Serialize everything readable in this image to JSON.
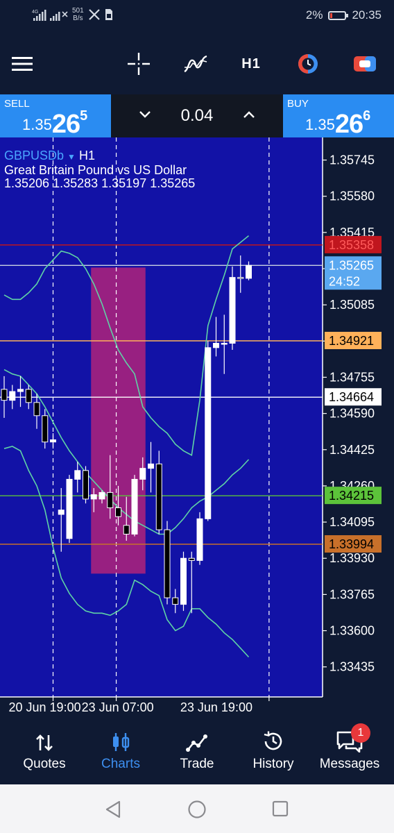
{
  "status_bar": {
    "network_speed_value": "501",
    "network_speed_unit": "B/s",
    "battery_percent": "2%",
    "time": "20:35"
  },
  "toolbar": {
    "timeframe": "H1",
    "icons": [
      "menu-icon",
      "crosshair-icon",
      "indicators-icon",
      "one-click-trading-icon",
      "trade-toggle-icon"
    ]
  },
  "trade": {
    "sell_label": "SELL",
    "sell_price_prefix": "1.35",
    "sell_price_big": "26",
    "sell_price_sup": "5",
    "buy_label": "BUY",
    "buy_price_prefix": "1.35",
    "buy_price_big": "26",
    "buy_price_sup": "6",
    "lot": "0.04"
  },
  "chart": {
    "symbol": "GBPUSDb",
    "timeframe": "H1",
    "description": "Great Britain Pound vs US Dollar",
    "ohlc": "1.35206 1.35283 1.35197 1.35265",
    "countdown": "24:52"
  },
  "colors": {
    "chart_bg": "#1212a6",
    "accent": "#2a8cf2",
    "bollinger": "#5fd3a6",
    "zone": "#b0237a",
    "bull": "#ffffff",
    "bear": "#000000"
  },
  "chart_data": {
    "type": "candlestick",
    "price_axis_ticks": [
      "1.35745",
      "1.35580",
      "1.35415",
      "1.35250",
      "1.35085",
      "1.34920",
      "1.34755",
      "1.34590",
      "1.34425",
      "1.34260",
      "1.34095",
      "1.33930",
      "1.33765",
      "1.33600",
      "1.33435"
    ],
    "time_axis_labels": [
      "20 Jun 19:00",
      "23 Jun 07:00",
      "23 Jun 19:00"
    ],
    "ylim": [
      1.33298,
      1.35848
    ],
    "horizontal_levels": [
      {
        "label": "1.35358",
        "price": 1.35358,
        "color": "#c0161e",
        "text_color": "#ff5a5a"
      },
      {
        "label": "1.35265",
        "price": 1.35265,
        "color": "#c8d0e0",
        "text_color": "#ffffff",
        "current": true
      },
      {
        "label": "1.34921",
        "price": 1.34921,
        "color": "#ffb15a",
        "text_color": "#000000"
      },
      {
        "label": "1.34664",
        "price": 1.34664,
        "color": "#ffffff",
        "text_color": "#000000"
      },
      {
        "label": "1.34215",
        "price": 1.34215,
        "color": "#5cc33a",
        "text_color": "#000000"
      },
      {
        "label": "1.33994",
        "price": 1.33994,
        "color": "#c8702a",
        "text_color": "#000000"
      }
    ],
    "candles": [
      [
        1.347,
        1.3476,
        1.3457,
        1.3465
      ],
      [
        1.3465,
        1.3472,
        1.3461,
        1.3469
      ],
      [
        1.3469,
        1.3476,
        1.3462,
        1.347
      ],
      [
        1.347,
        1.3472,
        1.3461,
        1.3464
      ],
      [
        1.3464,
        1.3468,
        1.3452,
        1.3458
      ],
      [
        1.3458,
        1.3461,
        1.3443,
        1.3446
      ],
      [
        1.3446,
        1.345,
        1.3443,
        1.3447
      ],
      [
        1.3413,
        1.3425,
        1.3396,
        1.3415
      ],
      [
        1.3402,
        1.3431,
        1.34,
        1.3429
      ],
      [
        1.3429,
        1.3437,
        1.3423,
        1.3433
      ],
      [
        1.3433,
        1.3435,
        1.3418,
        1.342
      ],
      [
        1.342,
        1.3425,
        1.3414,
        1.3422
      ],
      [
        1.342,
        1.3424,
        1.3418,
        1.3423
      ],
      [
        1.3423,
        1.344,
        1.3411,
        1.3416
      ],
      [
        1.3416,
        1.3426,
        1.3408,
        1.3412
      ],
      [
        1.3408,
        1.3421,
        1.3401,
        1.3404
      ],
      [
        1.3404,
        1.3431,
        1.3403,
        1.3429
      ],
      [
        1.3429,
        1.3439,
        1.3424,
        1.3434
      ],
      [
        1.3434,
        1.3446,
        1.3423,
        1.3436
      ],
      [
        1.3436,
        1.3442,
        1.3404,
        1.3406
      ],
      [
        1.3406,
        1.341,
        1.3372,
        1.3375
      ],
      [
        1.3375,
        1.3379,
        1.3368,
        1.3372
      ],
      [
        1.3372,
        1.3396,
        1.3369,
        1.3393
      ],
      [
        1.3393,
        1.3396,
        1.3368,
        1.3392
      ],
      [
        1.3392,
        1.3414,
        1.339,
        1.3411
      ],
      [
        1.3411,
        1.3492,
        1.341,
        1.3489
      ],
      [
        1.3489,
        1.3503,
        1.3485,
        1.3491
      ],
      [
        1.3491,
        1.3504,
        1.3477,
        1.3491
      ],
      [
        1.3491,
        1.3526,
        1.3488,
        1.3521
      ],
      [
        1.3521,
        1.3531,
        1.3514,
        1.35206
      ],
      [
        1.35206,
        1.35283,
        1.35197,
        1.35265
      ]
    ],
    "bollinger_upper": [
      1.3513,
      1.3511,
      1.3511,
      1.3514,
      1.3518,
      1.3525,
      1.3529,
      1.3533,
      1.3532,
      1.353,
      1.3525,
      1.3518,
      1.3509,
      1.3498,
      1.3488,
      1.3482,
      1.3477,
      1.3462,
      1.3457,
      1.3453,
      1.345,
      1.3445,
      1.3442,
      1.344,
      1.3465,
      1.3499,
      1.3511,
      1.3522,
      1.3534,
      1.3537,
      1.354
    ],
    "bollinger_middle": [
      1.3479,
      1.3477,
      1.3476,
      1.3472,
      1.3468,
      1.3462,
      1.3455,
      1.3448,
      1.3442,
      1.3437,
      1.3432,
      1.3428,
      1.3424,
      1.342,
      1.3416,
      1.3413,
      1.341,
      1.3408,
      1.3406,
      1.3404,
      1.3404,
      1.3407,
      1.3411,
      1.3416,
      1.3419,
      1.3421,
      1.3424,
      1.3427,
      1.3431,
      1.3434,
      1.3438
    ],
    "bollinger_lower": [
      1.3443,
      1.3444,
      1.3442,
      1.3433,
      1.3426,
      1.3415,
      1.3398,
      1.3384,
      1.3377,
      1.3372,
      1.3369,
      1.3368,
      1.3368,
      1.3367,
      1.3369,
      1.3372,
      1.3383,
      1.3381,
      1.3378,
      1.3376,
      1.3365,
      1.336,
      1.3362,
      1.337,
      1.337,
      1.3366,
      1.3363,
      1.3359,
      1.3356,
      1.3352,
      1.3348
    ],
    "zone": {
      "start_index": 11,
      "end_index": 17,
      "price_top": 1.35255,
      "price_bottom": 1.3386
    },
    "grid": false
  },
  "bottom_nav": [
    {
      "label": "Quotes",
      "icon": "quotes-icon",
      "active": false
    },
    {
      "label": "Charts",
      "icon": "charts-icon",
      "active": true
    },
    {
      "label": "Trade",
      "icon": "trade-icon",
      "active": false
    },
    {
      "label": "History",
      "icon": "history-icon",
      "active": false
    },
    {
      "label": "Messages",
      "icon": "messages-icon",
      "active": false,
      "badge": "1"
    }
  ]
}
